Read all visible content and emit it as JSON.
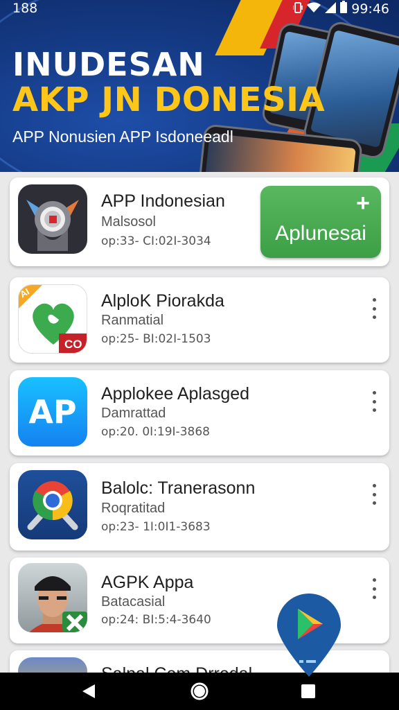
{
  "status": {
    "left": "188",
    "time": "99:46"
  },
  "banner": {
    "title_line1": "INUDESAN",
    "title_line2": "AKP JN DONESIA",
    "subtitle": "APP Nonusien APP Isdoneeadl"
  },
  "featured": {
    "name": "APP Indonesian",
    "developer": "Malsosol",
    "meta": "op:33- CI:02I-3034",
    "install_plus": "+",
    "install_label": "Aplunesai"
  },
  "apps": [
    {
      "name": "AlploK Piorakda",
      "developer": "Ranmatial",
      "meta": "op:25- BI:02I-1503",
      "icon_badge": "AI",
      "icon_tag": "CO"
    },
    {
      "name": "Applokee Aplasged",
      "developer": "Damrattad",
      "meta": "op:20. 0I:19I-3868",
      "icon_text": "AP"
    },
    {
      "name": "Balolc: Tranerasonn",
      "developer": "Roqratitad",
      "meta": "op:23- 1I:0I1-3683"
    },
    {
      "name": "AGPK Appa",
      "developer": "Batacasial",
      "meta": "op:24: BI:5:4-3640"
    },
    {
      "name": "Salpal Cem Drredal"
    }
  ],
  "colors": {
    "install": "#3c9e46",
    "banner": "#153b86",
    "title_accent": "#ffc61a",
    "fab": "#1c5aa3"
  }
}
